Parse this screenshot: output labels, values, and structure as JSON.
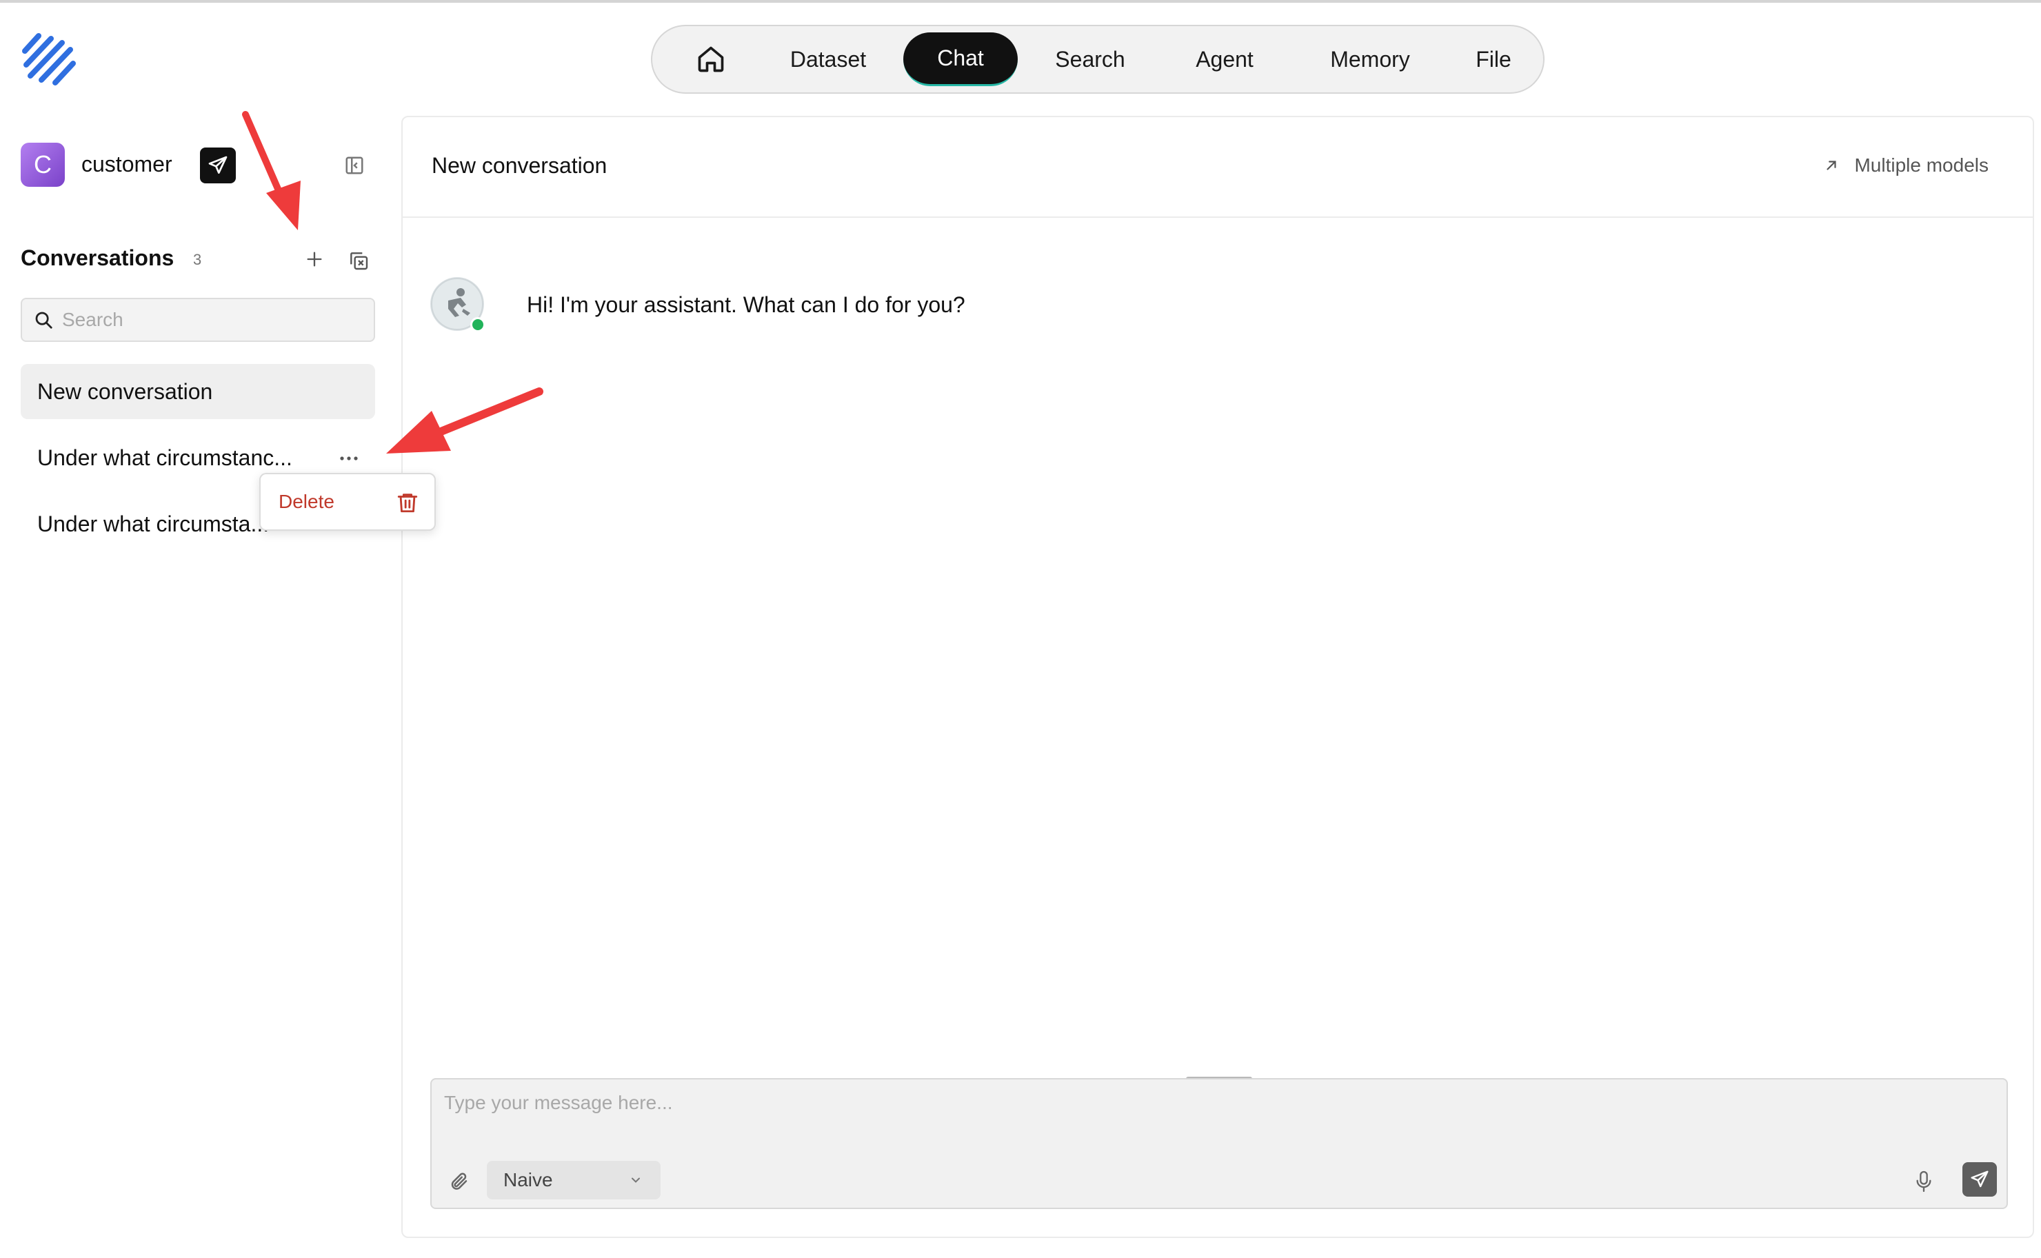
{
  "nav": {
    "items": [
      "Dataset",
      "Chat",
      "Search",
      "Agent",
      "Memory",
      "File"
    ],
    "active": "Chat"
  },
  "sidebar": {
    "avatar_letter": "C",
    "app_name": "customer",
    "conversations_title": "Conversations",
    "conversations_count": "3",
    "search_placeholder": "Search",
    "conversations": [
      "New conversation",
      "Under what circumstanc...",
      "Under what circumsta..."
    ],
    "menu": {
      "delete_label": "Delete"
    }
  },
  "main": {
    "title": "New conversation",
    "multiple_models": "Multiple models",
    "bot_message": "Hi! I'm your assistant. What can I do for you?",
    "input_placeholder": "Type your message here...",
    "mode": "Naive"
  },
  "colors": {
    "accent_dark": "#111111",
    "active_underline": "#27b8a6",
    "danger": "#c0392b",
    "online": "#21b35a",
    "annotation": "#ee3b3b"
  }
}
